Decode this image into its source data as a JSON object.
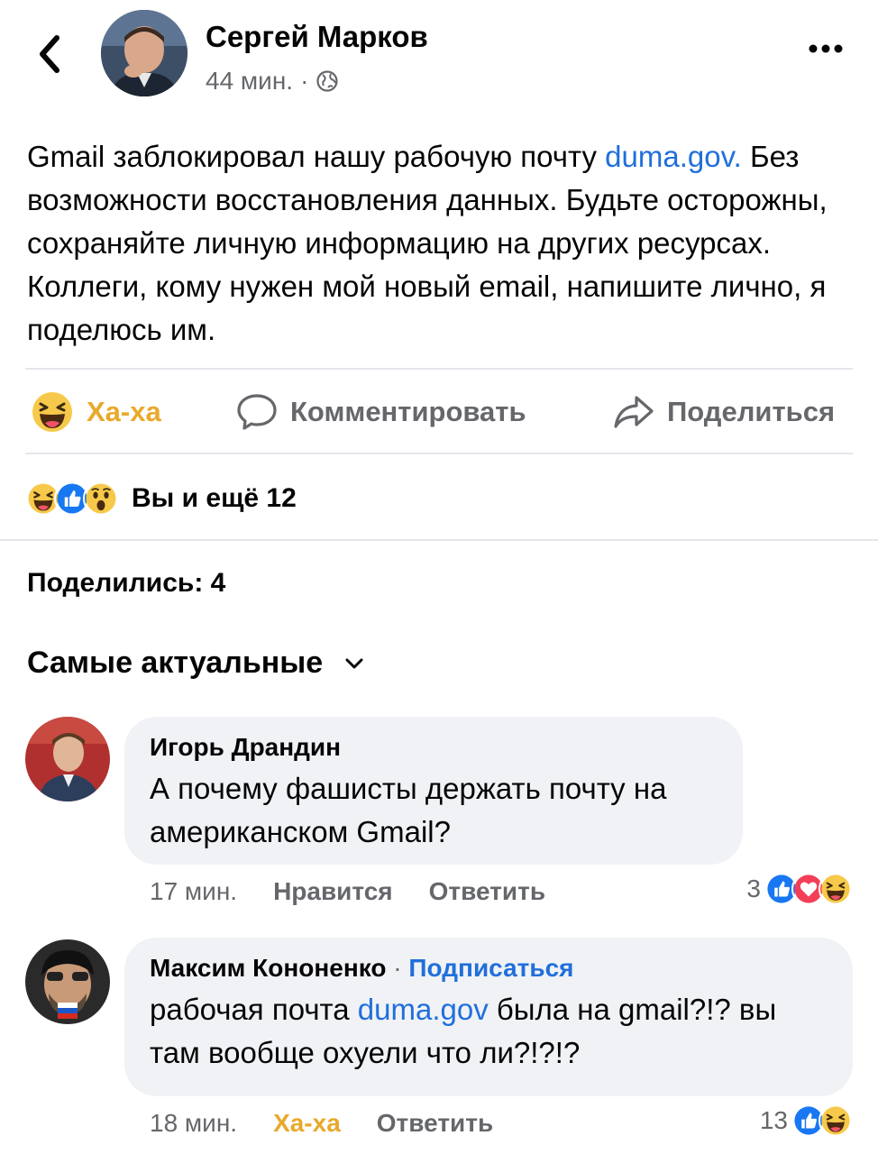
{
  "post": {
    "author": "Сергей Марков",
    "time": "44 мин.",
    "meta_separator": "·",
    "privacy_icon": "globe-icon",
    "text_part1": "Gmail заблокировал нашу рабочую почту ",
    "text_link": "duma.gov.",
    "text_part2": " Без возможности восстановления данных. Будьте осторожны, сохраняйте личную информацию на других ресурсах. Коллеги, кому нужен мой новый email, напишите лично, я поделюсь им."
  },
  "actions": {
    "reaction_label": "Ха-ха",
    "comment_label": "Комментировать",
    "share_label": "Поделиться"
  },
  "reactions": {
    "summary": "Вы и ещё 12",
    "icons": [
      "haha-icon",
      "like-icon",
      "wow-icon"
    ]
  },
  "shares": {
    "label": "Поделились: 4"
  },
  "sort": {
    "label": "Самые актуальные"
  },
  "comments": [
    {
      "author": "Игорь Драндин",
      "text": "А почему фашисты держать почту на американском Gmail?",
      "time": "17 мин.",
      "like_label": "Нравится",
      "reply_label": "Ответить",
      "reaction_count": "3",
      "reaction_icons": [
        "like-icon",
        "love-icon",
        "haha-icon"
      ]
    },
    {
      "author": "Максим Кононенко",
      "separator": "·",
      "subscribe_label": "Подписаться",
      "text_part1": "рабочая почта ",
      "text_link": "duma.gov",
      "text_part2": " была на gmail?!? вы там вообще охуели что ли?!?!?",
      "time": "18 мин.",
      "like_label": "Ха-ха",
      "reply_label": "Ответить",
      "reaction_count": "13",
      "reaction_icons": [
        "like-icon",
        "haha-icon"
      ]
    }
  ],
  "colors": {
    "link": "#216fdb",
    "secondary_text": "#65676b",
    "haha": "#e8a92b",
    "bubble": "#f0f2f5"
  }
}
